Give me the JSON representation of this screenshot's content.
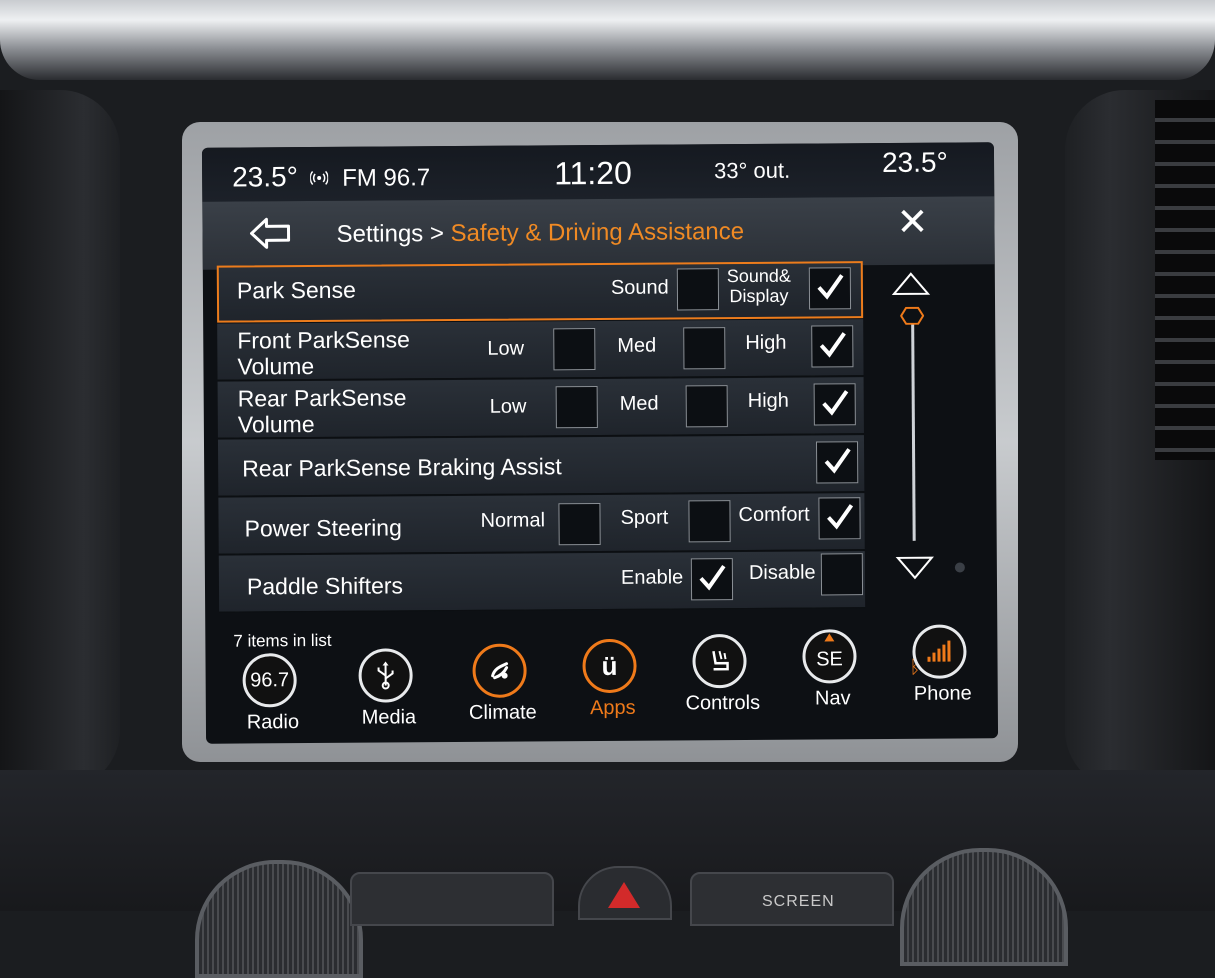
{
  "status": {
    "temp_left": "23.5°",
    "signal_icon": "radio-signal-icon",
    "radio": "FM 96.7",
    "clock": "11:20",
    "outside": "33° out.",
    "temp_right": "23.5°"
  },
  "header": {
    "crumb_root": "Settings",
    "crumb_sep": ">",
    "crumb_current": "Safety & Driving Assistance",
    "close": "✕"
  },
  "colors": {
    "accent": "#f08a24",
    "selected_outline": "#ec7c1c"
  },
  "settings": {
    "park_sense": {
      "label": "Park Sense",
      "opt1": "Sound",
      "opt1_checked": false,
      "opt2a": "Sound&",
      "opt2b": "Display",
      "opt2_checked": true
    },
    "front_volume": {
      "line1": "Front ParkSense",
      "line2": "Volume",
      "low": "Low",
      "med": "Med",
      "high": "High",
      "selected": "High"
    },
    "rear_volume": {
      "line1": "Rear ParkSense",
      "line2": "Volume",
      "low": "Low",
      "med": "Med",
      "high": "High",
      "selected": "High"
    },
    "braking_assist": {
      "label": "Rear ParkSense Braking Assist",
      "checked": true
    },
    "power_steering": {
      "label": "Power Steering",
      "normal": "Normal",
      "sport": "Sport",
      "comfort": "Comfort",
      "selected": "Comfort"
    },
    "paddle_shifters": {
      "label": "Paddle Shifters",
      "enable": "Enable",
      "disable": "Disable",
      "selected": "Enable"
    }
  },
  "list_count": "7 items in list",
  "dock": {
    "radio": {
      "icon_text": "96.7",
      "label": "Radio"
    },
    "media": {
      "icon": "usb-icon",
      "label": "Media"
    },
    "climate": {
      "icon": "climate-fan-icon",
      "label": "Climate"
    },
    "apps": {
      "icon_text": "ü",
      "label": "Apps",
      "active": true
    },
    "controls": {
      "icon": "seat-icon",
      "label": "Controls"
    },
    "nav": {
      "icon_text": "SE",
      "label": "Nav"
    },
    "phone": {
      "icon": "signal-bars-icon",
      "label": "Phone"
    }
  },
  "console": {
    "screen_button": "SCREEN"
  }
}
